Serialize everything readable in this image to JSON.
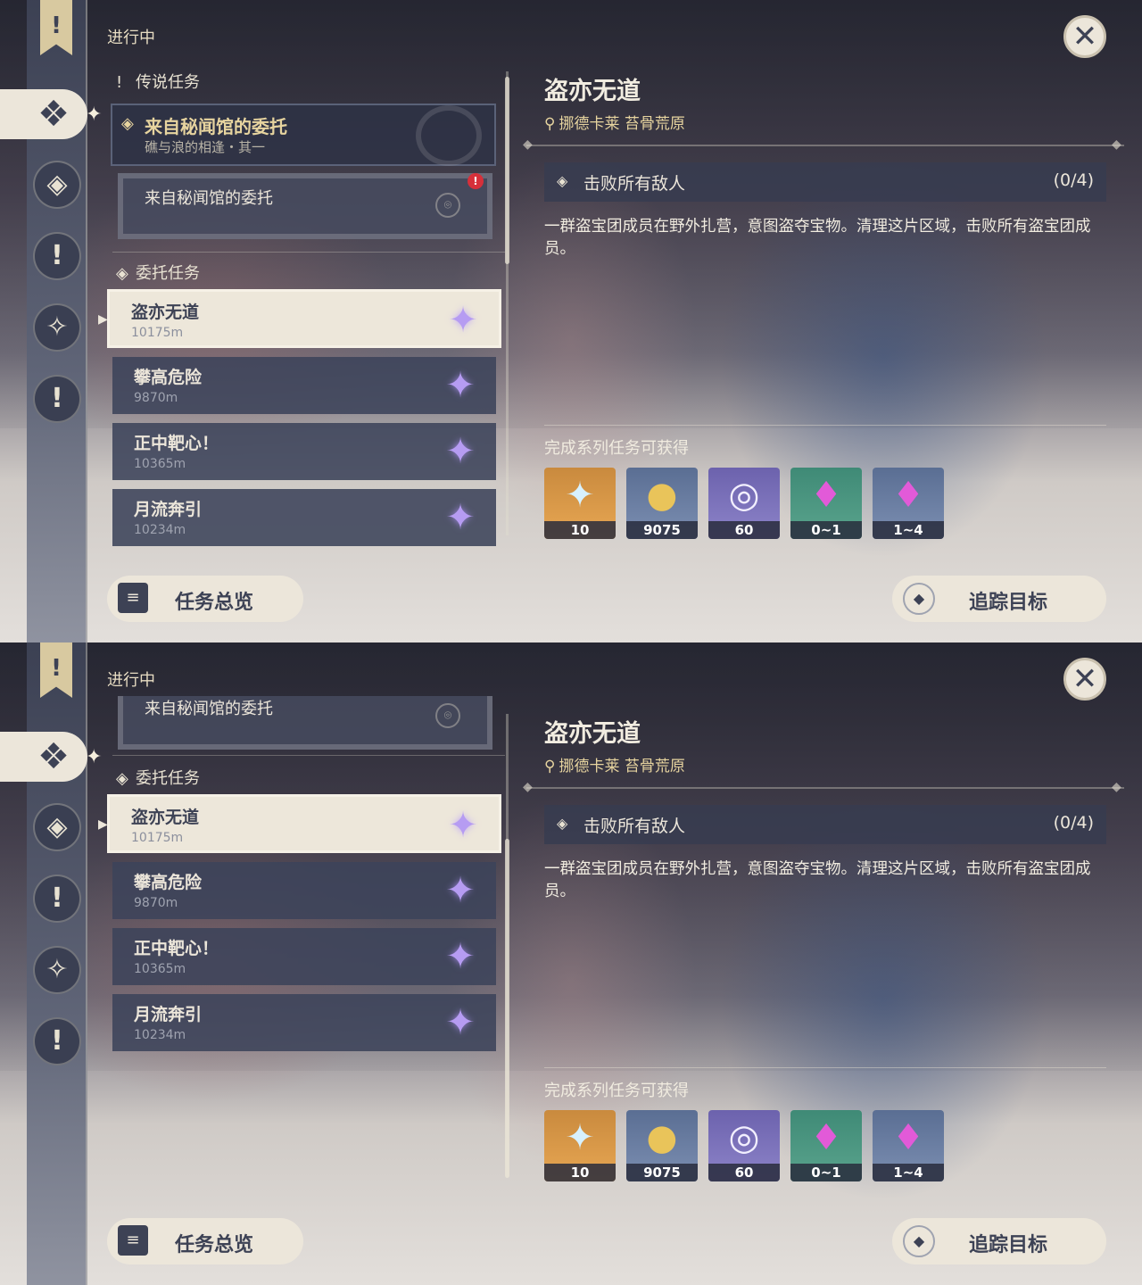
{
  "header": {
    "progress_label": "进行中",
    "close_icon_glyph": "✕"
  },
  "rail": {
    "banner_glyph": "!",
    "buttons": [
      {
        "icon": "quest-diamond-icon",
        "glyph": "❖"
      },
      {
        "icon": "legend-icon",
        "glyph": "◈"
      },
      {
        "icon": "exclaim-icon",
        "glyph": "!"
      },
      {
        "icon": "commission-icon",
        "glyph": "✧"
      },
      {
        "icon": "world-icon",
        "glyph": "!"
      }
    ]
  },
  "legend_section": {
    "title": "传说任务",
    "card_title": "来自秘闻馆的委托",
    "card_subtitle": "礁与浪的相逢・其一",
    "sub_card_title": "来自秘闻馆的委托"
  },
  "commission_section": {
    "title": "委托任务"
  },
  "quests": [
    {
      "name": "盗亦无道",
      "distance": "10175m"
    },
    {
      "name": "攀高危险",
      "distance": "9870m"
    },
    {
      "name": "正中靶心！",
      "distance": "10365m"
    },
    {
      "name": "月流奔引",
      "distance": "10234m"
    }
  ],
  "buttons": {
    "overview": "任务总览",
    "track": "追踪目标"
  },
  "detail": {
    "title": "盗亦无道",
    "location": "挪德卡莱 苔骨荒原",
    "objective": "击败所有敌人",
    "objective_count": "(0/4)",
    "description": "一群盗宝团成员在野外扎营，意图盗夺宝物。清理这片区域，击败所有盗宝团成员。",
    "rewards_title": "完成系列任务可获得",
    "rewards": [
      {
        "icon": "primogem-icon",
        "glyph": "✦",
        "count": "10"
      },
      {
        "icon": "mora-icon",
        "glyph": "●",
        "count": "9075"
      },
      {
        "icon": "companionship-exp-icon",
        "glyph": "◎",
        "count": "60"
      },
      {
        "icon": "crystal-icon",
        "glyph": "♦",
        "count": "0~1"
      },
      {
        "icon": "crystal-cluster-icon",
        "glyph": "♦",
        "count": "1~4"
      }
    ]
  }
}
